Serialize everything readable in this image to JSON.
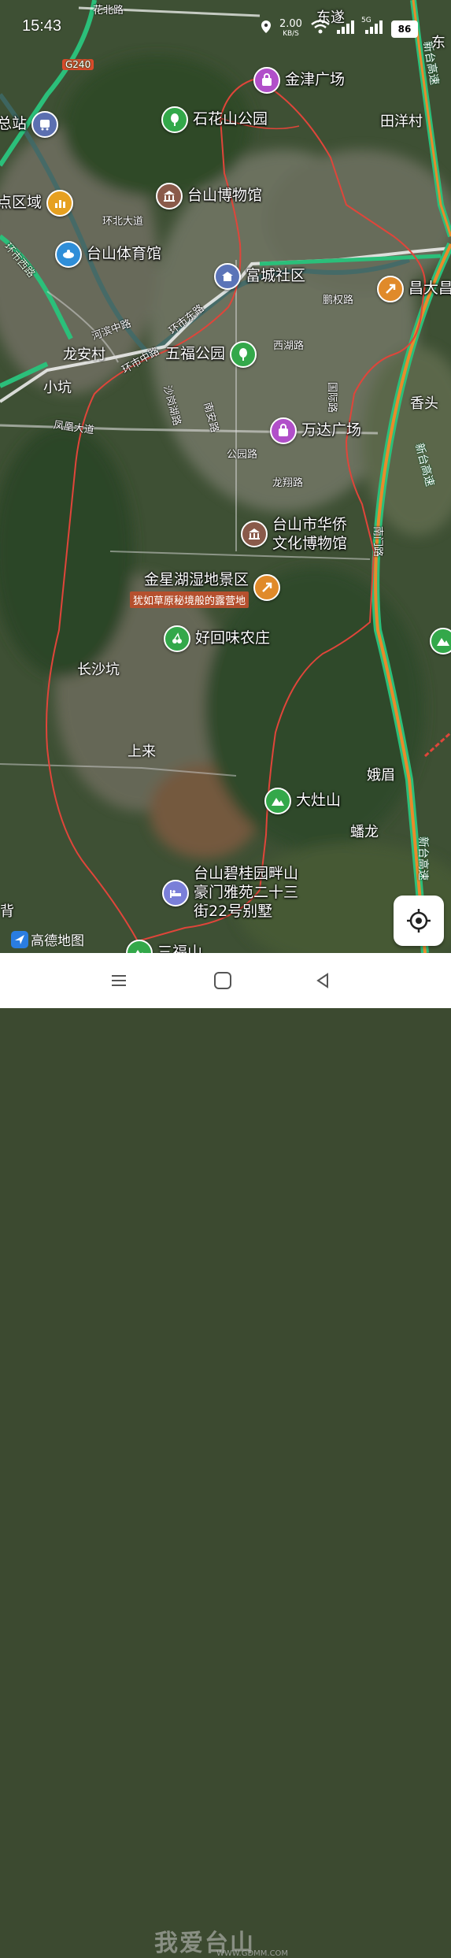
{
  "status_bar": {
    "time": "15:43",
    "net_speed": "2.00",
    "net_unit": "KB/S",
    "signal_label": "5G",
    "battery": "86"
  },
  "map": {
    "provider_logo": "高德地图",
    "pois": [
      {
        "id": "jinjin",
        "label": "金津广场",
        "icon": "shopping-bag-icon",
        "color": "#b14fc9"
      },
      {
        "id": "shihuashan",
        "label": "石花山公园",
        "icon": "tree-icon",
        "color": "#33a84a"
      },
      {
        "id": "museum",
        "label": "台山博物馆",
        "icon": "museum-icon",
        "color": "#8a5a4a"
      },
      {
        "id": "bus",
        "label": "总站",
        "icon": "bus-icon",
        "color": "#5b6fb0"
      },
      {
        "id": "scenic",
        "label": "点区域",
        "icon": "scenic-area-icon",
        "color": "#e6a020"
      },
      {
        "id": "gym",
        "label": "台山体育馆",
        "icon": "stadium-icon",
        "color": "#2f8ed8"
      },
      {
        "id": "fucheng",
        "label": "富城社区",
        "icon": "community-icon",
        "color": "#5b74b8"
      },
      {
        "id": "changda",
        "label": "昌大昌",
        "icon": "shop-icon",
        "color": "#e08a2a"
      },
      {
        "id": "wufu",
        "label": "五福公园",
        "icon": "tree-icon",
        "color": "#33a84a"
      },
      {
        "id": "wanda",
        "label": "万达广场",
        "icon": "shopping-bag-icon",
        "color": "#b14fc9"
      },
      {
        "id": "huaqiao",
        "label": "台山市华侨",
        "label2": "文化博物馆",
        "icon": "museum-icon",
        "color": "#8a5a4a"
      },
      {
        "id": "jinxinghu",
        "label": "金星湖湿地景区",
        "sub": "犹如草原秘境般的露营地",
        "icon": "camp-icon",
        "color": "#e08a2a"
      },
      {
        "id": "haohuiwei",
        "label": "好回味农庄",
        "icon": "cherry-icon",
        "color": "#33a84a"
      },
      {
        "id": "dazao",
        "label": "大灶山",
        "icon": "mountain-icon",
        "color": "#33a84a"
      },
      {
        "id": "biguiyuan",
        "label": "台山碧桂园畔山",
        "label2": "豪门雅苑二十三",
        "label3": "街22号别墅",
        "icon": "bed-icon",
        "color": "#7a7fd8"
      },
      {
        "id": "sanjia",
        "label": "三福山",
        "icon": "mountain-icon",
        "color": "#33a84a"
      }
    ],
    "places": {
      "dongsui": "东遂",
      "dong": "东",
      "tianyang": "田洋村",
      "longan": "龙安村",
      "xiaokeng": "小坑",
      "xiangtou": "香头",
      "changshakeng": "长沙坑",
      "shanglai": "上来",
      "emei": "娥眉",
      "panlong": "蟠龙",
      "beiqian": "背"
    },
    "roads": {
      "g240": "G240",
      "huanbei_road": "环北大道",
      "hebin_road": "河滨中路",
      "huanshi_zhong": "环市中路",
      "huanshi_dong": "环市东路",
      "xihu": "西湖路",
      "shagang": "沙岗湖路",
      "nanan": "南安路",
      "gongyuan": "公园路",
      "longxiang": "龙翔路",
      "guoji": "国际路",
      "pengquan": "鹏权路",
      "fenghuang": "凤凰大道",
      "nanmen": "南门路",
      "xintai": "新台高速",
      "huabei": "花北路",
      "huanshi_xi": "环市西路"
    },
    "route_color": "#e0453a",
    "highway_color": "#e98a2b"
  },
  "watermark": {
    "text": "我爱台山",
    "url": "WWW.GDMM.COM"
  }
}
